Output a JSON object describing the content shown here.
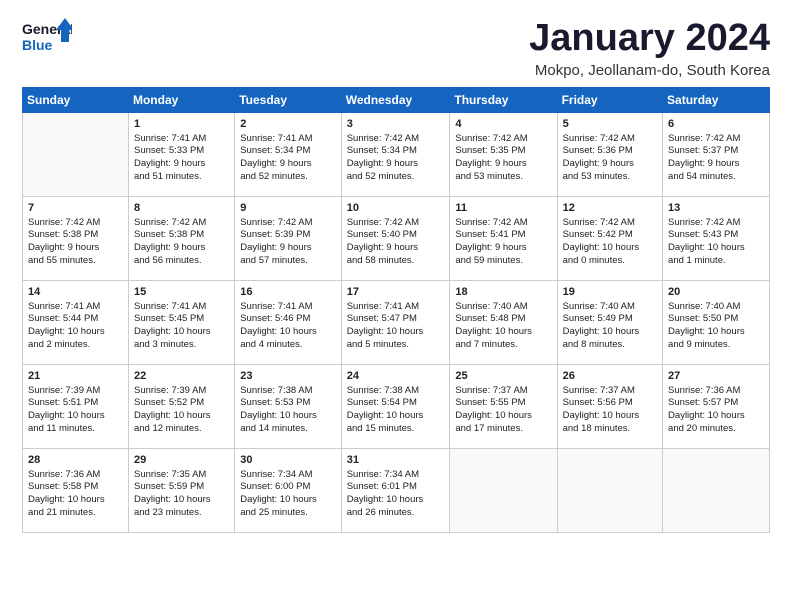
{
  "logo": {
    "line1": "General",
    "line2": "Blue"
  },
  "title": "January 2024",
  "subtitle": "Mokpo, Jeollanam-do, South Korea",
  "days_of_week": [
    "Sunday",
    "Monday",
    "Tuesday",
    "Wednesday",
    "Thursday",
    "Friday",
    "Saturday"
  ],
  "weeks": [
    [
      {
        "num": "",
        "data": ""
      },
      {
        "num": "1",
        "data": "Sunrise: 7:41 AM\nSunset: 5:33 PM\nDaylight: 9 hours\nand 51 minutes."
      },
      {
        "num": "2",
        "data": "Sunrise: 7:41 AM\nSunset: 5:34 PM\nDaylight: 9 hours\nand 52 minutes."
      },
      {
        "num": "3",
        "data": "Sunrise: 7:42 AM\nSunset: 5:34 PM\nDaylight: 9 hours\nand 52 minutes."
      },
      {
        "num": "4",
        "data": "Sunrise: 7:42 AM\nSunset: 5:35 PM\nDaylight: 9 hours\nand 53 minutes."
      },
      {
        "num": "5",
        "data": "Sunrise: 7:42 AM\nSunset: 5:36 PM\nDaylight: 9 hours\nand 53 minutes."
      },
      {
        "num": "6",
        "data": "Sunrise: 7:42 AM\nSunset: 5:37 PM\nDaylight: 9 hours\nand 54 minutes."
      }
    ],
    [
      {
        "num": "7",
        "data": "Sunrise: 7:42 AM\nSunset: 5:38 PM\nDaylight: 9 hours\nand 55 minutes."
      },
      {
        "num": "8",
        "data": "Sunrise: 7:42 AM\nSunset: 5:38 PM\nDaylight: 9 hours\nand 56 minutes."
      },
      {
        "num": "9",
        "data": "Sunrise: 7:42 AM\nSunset: 5:39 PM\nDaylight: 9 hours\nand 57 minutes."
      },
      {
        "num": "10",
        "data": "Sunrise: 7:42 AM\nSunset: 5:40 PM\nDaylight: 9 hours\nand 58 minutes."
      },
      {
        "num": "11",
        "data": "Sunrise: 7:42 AM\nSunset: 5:41 PM\nDaylight: 9 hours\nand 59 minutes."
      },
      {
        "num": "12",
        "data": "Sunrise: 7:42 AM\nSunset: 5:42 PM\nDaylight: 10 hours\nand 0 minutes."
      },
      {
        "num": "13",
        "data": "Sunrise: 7:42 AM\nSunset: 5:43 PM\nDaylight: 10 hours\nand 1 minute."
      }
    ],
    [
      {
        "num": "14",
        "data": "Sunrise: 7:41 AM\nSunset: 5:44 PM\nDaylight: 10 hours\nand 2 minutes."
      },
      {
        "num": "15",
        "data": "Sunrise: 7:41 AM\nSunset: 5:45 PM\nDaylight: 10 hours\nand 3 minutes."
      },
      {
        "num": "16",
        "data": "Sunrise: 7:41 AM\nSunset: 5:46 PM\nDaylight: 10 hours\nand 4 minutes."
      },
      {
        "num": "17",
        "data": "Sunrise: 7:41 AM\nSunset: 5:47 PM\nDaylight: 10 hours\nand 5 minutes."
      },
      {
        "num": "18",
        "data": "Sunrise: 7:40 AM\nSunset: 5:48 PM\nDaylight: 10 hours\nand 7 minutes."
      },
      {
        "num": "19",
        "data": "Sunrise: 7:40 AM\nSunset: 5:49 PM\nDaylight: 10 hours\nand 8 minutes."
      },
      {
        "num": "20",
        "data": "Sunrise: 7:40 AM\nSunset: 5:50 PM\nDaylight: 10 hours\nand 9 minutes."
      }
    ],
    [
      {
        "num": "21",
        "data": "Sunrise: 7:39 AM\nSunset: 5:51 PM\nDaylight: 10 hours\nand 11 minutes."
      },
      {
        "num": "22",
        "data": "Sunrise: 7:39 AM\nSunset: 5:52 PM\nDaylight: 10 hours\nand 12 minutes."
      },
      {
        "num": "23",
        "data": "Sunrise: 7:38 AM\nSunset: 5:53 PM\nDaylight: 10 hours\nand 14 minutes."
      },
      {
        "num": "24",
        "data": "Sunrise: 7:38 AM\nSunset: 5:54 PM\nDaylight: 10 hours\nand 15 minutes."
      },
      {
        "num": "25",
        "data": "Sunrise: 7:37 AM\nSunset: 5:55 PM\nDaylight: 10 hours\nand 17 minutes."
      },
      {
        "num": "26",
        "data": "Sunrise: 7:37 AM\nSunset: 5:56 PM\nDaylight: 10 hours\nand 18 minutes."
      },
      {
        "num": "27",
        "data": "Sunrise: 7:36 AM\nSunset: 5:57 PM\nDaylight: 10 hours\nand 20 minutes."
      }
    ],
    [
      {
        "num": "28",
        "data": "Sunrise: 7:36 AM\nSunset: 5:58 PM\nDaylight: 10 hours\nand 21 minutes."
      },
      {
        "num": "29",
        "data": "Sunrise: 7:35 AM\nSunset: 5:59 PM\nDaylight: 10 hours\nand 23 minutes."
      },
      {
        "num": "30",
        "data": "Sunrise: 7:34 AM\nSunset: 6:00 PM\nDaylight: 10 hours\nand 25 minutes."
      },
      {
        "num": "31",
        "data": "Sunrise: 7:34 AM\nSunset: 6:01 PM\nDaylight: 10 hours\nand 26 minutes."
      },
      {
        "num": "",
        "data": ""
      },
      {
        "num": "",
        "data": ""
      },
      {
        "num": "",
        "data": ""
      }
    ]
  ]
}
